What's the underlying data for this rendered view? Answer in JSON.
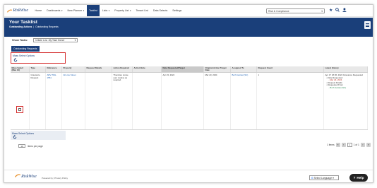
{
  "brand": {
    "logo_text": "RiskWise"
  },
  "nav": {
    "items": [
      {
        "label": "Home",
        "has_caret": false
      },
      {
        "label": "Dashboards",
        "has_caret": true
      },
      {
        "label": "New Planner",
        "has_caret": true
      },
      {
        "label": "Tasklist",
        "has_caret": false,
        "active": true
      },
      {
        "label": "Lists",
        "has_caret": true
      },
      {
        "label": "Property List",
        "has_caret": true
      },
      {
        "label": "Tenant List",
        "has_caret": false
      },
      {
        "label": "Data Selects",
        "has_caret": false
      },
      {
        "label": "Settings",
        "has_caret": false
      }
    ],
    "site_select": "Risk & Compliance"
  },
  "title": {
    "page_title": "Your Tasklist",
    "breadcrumb_1": "Outstanding Actions",
    "breadcrumb_2": "Outstanding Requests"
  },
  "filters": {
    "show_tasks_label": "Show Tasks:",
    "show_tasks_value": "Initiate Low .My Task Owner"
  },
  "tab": {
    "label": "Outstanding Requests"
  },
  "mass_select": {
    "label": "Mass Select Options"
  },
  "table": {
    "headers": [
      "Mass Select (Max 10)",
      "Type",
      "Reference",
      "Property",
      "Request Details",
      "Action Required",
      "Action Note",
      "Date Requested/Target",
      "Original Action Target Date",
      "Assigned To",
      "Request Count",
      "Latest History"
    ],
    "row": {
      "type": "Grievance Request",
      "reference": "ARV-TOH-1551",
      "property": "Ali Line Street",
      "request_details": "",
      "action_required": "Therefore revise your resolve as required.",
      "action_note": "",
      "date_requested": "Apr 23, 2024",
      "original_target": "Mar 23, 2024",
      "assigned_to": "Borh Gariasi (SC)",
      "request_count": "1",
      "history_head": "Apr 17 18:36, 2024 Grievance Requested",
      "history_items": [
        {
          "label": "Date Requested",
          "value": "- Mar 23, 2024",
          "color": "red"
        },
        {
          "label": "Request Details",
          "value": "",
          "color": "none"
        },
        {
          "label": "Requested From",
          "value": "- Borh Gariasi (SC)",
          "color": "green"
        }
      ]
    }
  },
  "pagination": {
    "per_page_value": "10",
    "per_page_label": "items per page",
    "total": "1 items",
    "page": "1",
    "of_label": "1 of 1"
  },
  "footer": {
    "text": "Powered by | Privacy Policy",
    "language": "Select Language",
    "help": "Help"
  }
}
